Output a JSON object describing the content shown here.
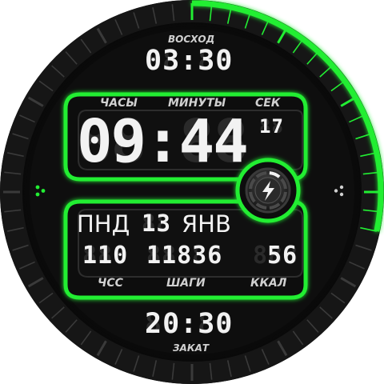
{
  "watch": {
    "sunrise_label": "ВОСХОД",
    "sunrise_time": "03:30",
    "sunset_label": "ЗАКАТ",
    "sunset_time": "20:30",
    "hours_label": "ЧАСЫ",
    "minutes_label": "МИНУТЫ",
    "seconds_label": "СЕК",
    "time": "09:44",
    "seconds": "17",
    "weekday": "ПНД",
    "day": "13",
    "month": "ЯНВ",
    "heart_rate": "110",
    "steps": "11836",
    "calories": "56",
    "heart_rate_label": "ЧСС",
    "steps_label": "ШАГИ",
    "calories_label": "ККАЛ",
    "bezel_seconds_value": 17,
    "accent_color": "#22ee33",
    "icon": "lightning-icon"
  }
}
